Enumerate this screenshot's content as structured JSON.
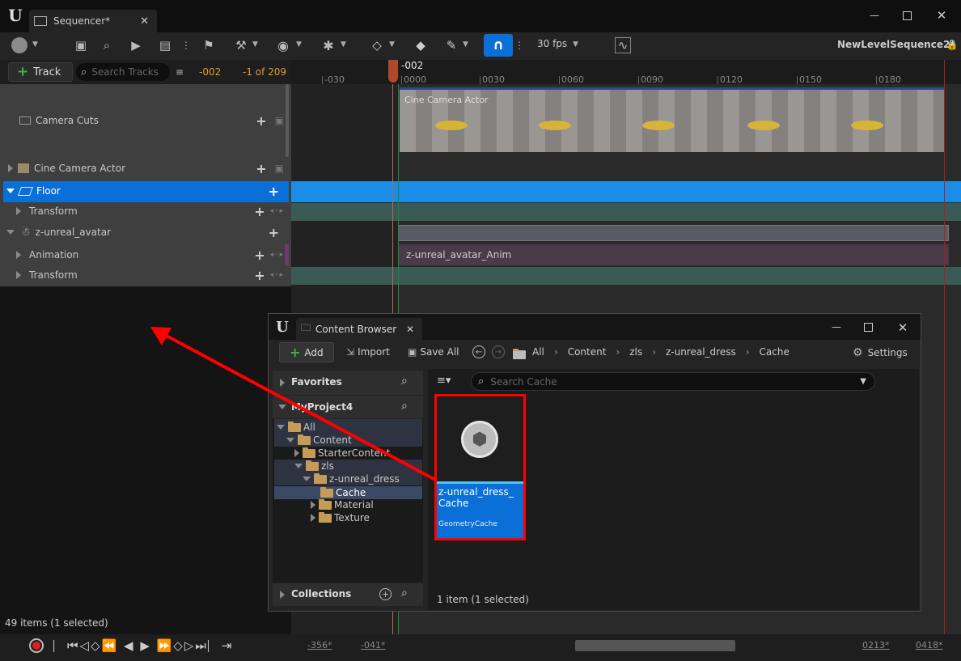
{
  "window": {
    "tab_title": "Sequencer*",
    "controls": [
      "minimize-icon",
      "maximize-icon",
      "close-icon"
    ]
  },
  "toolbar": {
    "fps": "30 fps",
    "sequence_name": "NewLevelSequence2*"
  },
  "tracks_header": {
    "add_track": "Track",
    "search_placeholder": "Search Tracks",
    "frame_current": "-002",
    "frame_range": "-1 of 209"
  },
  "timeline": {
    "playhead": "-002",
    "ticks": [
      "-030",
      "0000",
      "0030",
      "0060",
      "0090",
      "0120",
      "0150",
      "0180"
    ]
  },
  "tracks": [
    {
      "label": "Camera Cuts"
    },
    {
      "label": "Cine Camera Actor"
    },
    {
      "label": "Floor"
    },
    {
      "label": "Transform"
    },
    {
      "label": "z-unreal_avatar"
    },
    {
      "label": "Animation"
    },
    {
      "label": "Transform"
    }
  ],
  "sections": {
    "camera_section": "Cine Camera Actor",
    "anim_section": "z-unreal_avatar_Anim"
  },
  "status": {
    "items": "49 items (1 selected)"
  },
  "bottom": {
    "start": "-356*",
    "in": "-041*",
    "out": "0213*",
    "end": "0418*"
  },
  "content_browser": {
    "title": "Content Browser",
    "add": "Add",
    "import": "Import",
    "save_all": "Save All",
    "path": [
      "All",
      "Content",
      "zls",
      "z-unreal_dress",
      "Cache"
    ],
    "settings": "Settings",
    "favorites": "Favorites",
    "project": "MyProject4",
    "tree": [
      "All",
      "Content",
      "StarterContent",
      "zls",
      "z-unreal_dress",
      "Cache",
      "Material",
      "Texture"
    ],
    "collections": "Collections",
    "search_placeholder": "Search Cache",
    "asset": {
      "name": "z-unreal_dress_Cache",
      "type": "GeometryCache"
    },
    "count": "1 item (1 selected)"
  },
  "colors": {
    "selected": "#0a70d8",
    "accent_orange": "#e59a2b",
    "annotation": "#ff0000"
  }
}
